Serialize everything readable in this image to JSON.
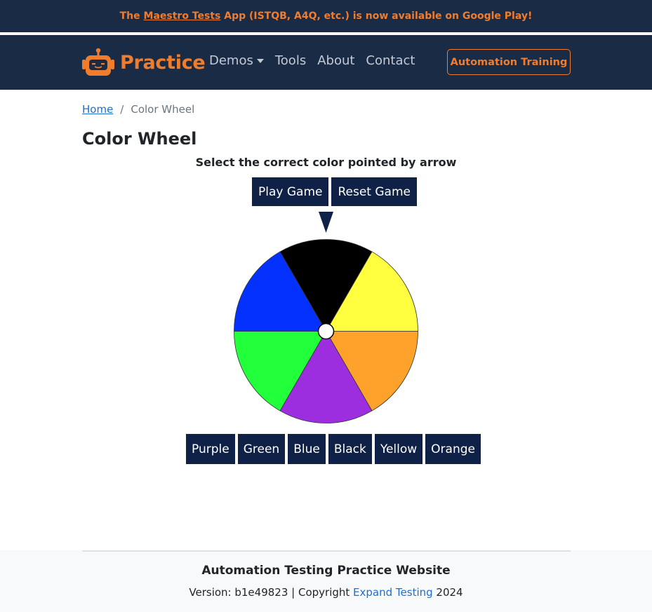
{
  "announcement": {
    "prefix": "The ",
    "link": "Maestro Tests",
    "suffix": " App (ISTQB, A4Q, etc.) is now available on Google Play!",
    "color": "#f07d2d"
  },
  "navbar": {
    "brand": "Practice",
    "brand_icon": "robot-icon",
    "links": [
      {
        "label": "Demos",
        "dropdown": true
      },
      {
        "label": "Tools"
      },
      {
        "label": "About"
      },
      {
        "label": "Contact"
      }
    ],
    "cta": "Automation Training",
    "background": "#1a2b46"
  },
  "breadcrumb": {
    "home": "Home",
    "separator": "/",
    "current": "Color Wheel"
  },
  "page": {
    "title": "Color Wheel",
    "instruction": "Select the correct color pointed by arrow"
  },
  "game_buttons": {
    "play": "Play Game",
    "reset": "Reset Game"
  },
  "wheel": {
    "pointer_icon": "triangle-down-icon",
    "segments": [
      {
        "name": "Black",
        "color": "#000000"
      },
      {
        "name": "Yellow",
        "color": "#ffff40"
      },
      {
        "name": "Orange",
        "color": "#ffa22b"
      },
      {
        "name": "Purple",
        "color": "#9c2ee0"
      },
      {
        "name": "Green",
        "color": "#22ff3b"
      },
      {
        "name": "Blue",
        "color": "#0531ff"
      }
    ]
  },
  "answers": [
    "Purple",
    "Green",
    "Blue",
    "Black",
    "Yellow",
    "Orange"
  ],
  "footer": {
    "title": "Automation Testing Practice Website",
    "version_text": "Version: b1e49823 | Copyright ",
    "company": "Expand Testing",
    "year": " 2024"
  }
}
